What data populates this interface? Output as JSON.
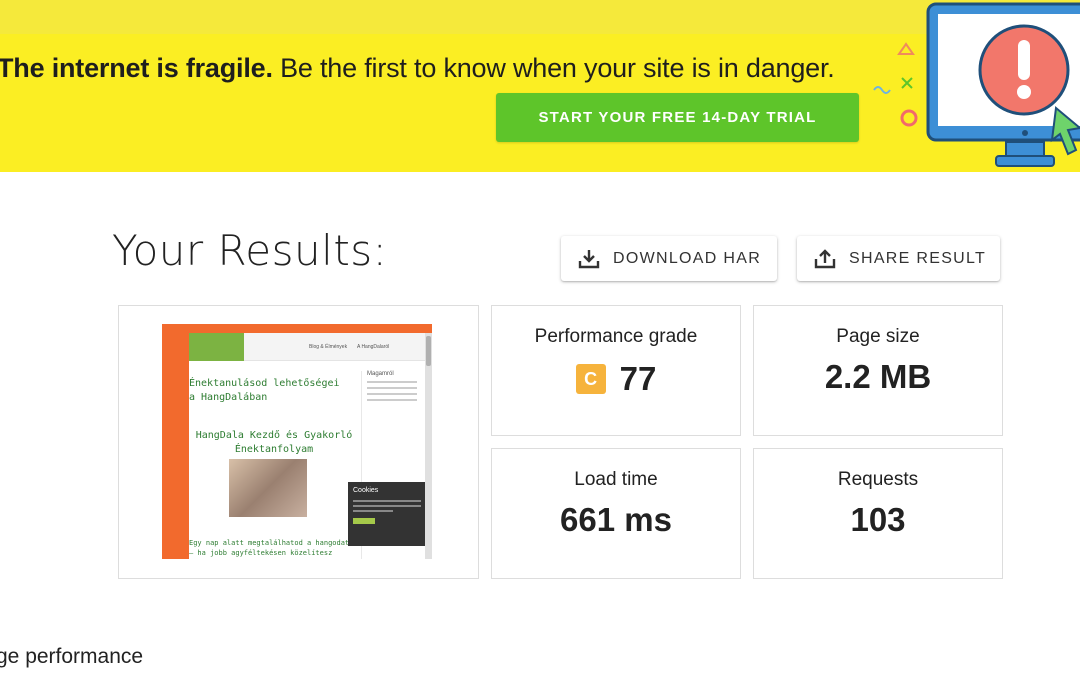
{
  "banner": {
    "headline_bold": "The internet is fragile.",
    "headline_rest": " Be the first to know when your site is in danger.",
    "cta_label": "START YOUR FREE 14-DAY TRIAL",
    "colors": {
      "background": "#fbee23",
      "cta": "#5ec52a"
    }
  },
  "results": {
    "title": "Your Results:",
    "download_label": "DOWNLOAD HAR",
    "share_label": "SHARE RESULT"
  },
  "thumbnail": {
    "heading": "Énektanulásod lehetőségei a HangDalában",
    "subheading": "HangDala Kezdő és Gyakorló Énektanfolyam",
    "bottom_text": "Egy nap alatt megtalálhatod a hangodat – ha jobb agyféltekésen közelítesz",
    "nav_items": [
      "Blog & Élmények",
      "A HangDalaról"
    ],
    "sidebar_title": "Magamról",
    "cookie_title": "Cookies",
    "colors": {
      "frame": "#f26a2d",
      "accent": "#2e7d32"
    }
  },
  "metrics": {
    "grade": {
      "label": "Performance grade",
      "letter": "C",
      "score": "77",
      "color": "#f6b33c"
    },
    "page_size": {
      "label": "Page size",
      "value": "2.2 MB"
    },
    "load_time": {
      "label": "Load time",
      "value": "661 ms"
    },
    "requests": {
      "label": "Requests",
      "value": "103"
    }
  },
  "section_partial": "ge performance"
}
